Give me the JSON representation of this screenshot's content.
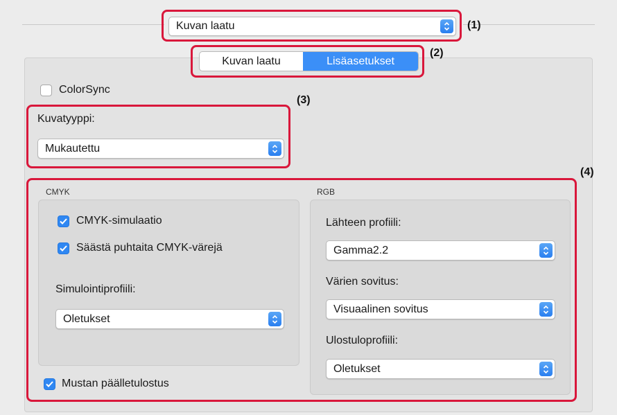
{
  "top_popup": {
    "value": "Kuvan laatu"
  },
  "segments": [
    {
      "label": "Kuvan laatu",
      "selected": false
    },
    {
      "label": "Lisäasetukset",
      "selected": true
    }
  ],
  "colorsync": {
    "label": "ColorSync",
    "checked": false
  },
  "image_type": {
    "label": "Kuvatyyppi:",
    "value": "Mukautettu"
  },
  "cmyk": {
    "title": "CMYK",
    "simulation": {
      "label": "CMYK-simulaatio",
      "checked": true
    },
    "preserve": {
      "label": "Säästä puhtaita CMYK-värejä",
      "checked": true
    },
    "profile_label": "Simulointiprofiili:",
    "profile_value": "Oletukset"
  },
  "rgb": {
    "title": "RGB",
    "source_label": "Lähteen profiili:",
    "source_value": "Gamma2.2",
    "matching_label": "Värien sovitus:",
    "matching_value": "Visuaalinen sovitus",
    "output_label": "Ulostuloprofiili:",
    "output_value": "Oletukset"
  },
  "black_overprint": {
    "label": "Mustan päälletulostus",
    "checked": true
  },
  "callouts": [
    "(1)",
    "(2)",
    "(3)",
    "(4)"
  ],
  "colors": {
    "accent": "#2f87f2",
    "highlight": "#d9173b"
  }
}
